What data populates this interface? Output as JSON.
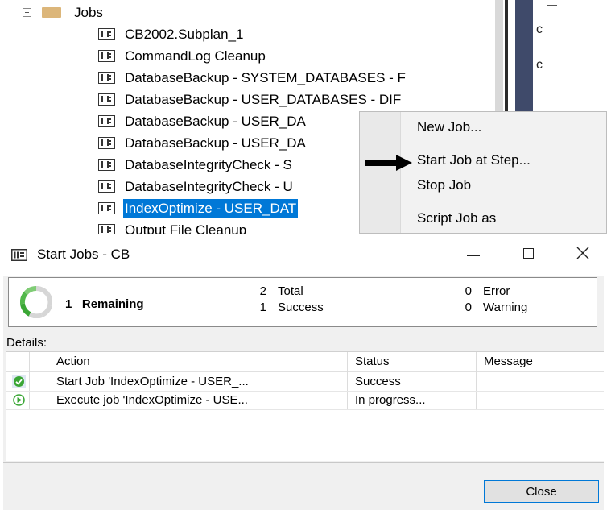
{
  "explorer": {
    "jobs_folder_label": "Jobs",
    "jobs": [
      "CB2002.Subplan_1",
      "CommandLog Cleanup",
      "DatabaseBackup - SYSTEM_DATABASES - F",
      "DatabaseBackup - USER_DATABASES - DIF",
      "DatabaseBackup - USER_DA",
      "DatabaseBackup - USER_DA",
      "DatabaseIntegrityCheck - S",
      "DatabaseIntegrityCheck - U",
      "IndexOptimize - USER_DAT",
      "Output File Cleanup"
    ],
    "selected_index": 8,
    "right_pane_chars": [
      "c",
      "c"
    ]
  },
  "context_menu": {
    "items": [
      "New Job...",
      "Start Job at Step...",
      "Stop Job",
      "Script Job as"
    ],
    "highlighted_item": "Start Job at Step..."
  },
  "dialog": {
    "title": "Start Jobs - CB",
    "summary": {
      "remaining_count": "1",
      "remaining_label": "Remaining",
      "total_count": "2",
      "total_label": "Total",
      "success_count": "1",
      "success_label": "Success",
      "error_count": "0",
      "error_label": "Error",
      "warning_count": "0",
      "warning_label": "Warning"
    },
    "details_label": "Details:",
    "columns": [
      "Action",
      "Status",
      "Message"
    ],
    "rows": [
      {
        "icon": "success-check-icon",
        "action": "Start Job 'IndexOptimize - USER_...",
        "status": "Success",
        "message": ""
      },
      {
        "icon": "play-progress-icon",
        "action": "Execute job 'IndexOptimize - USE...",
        "status": "In progress...",
        "message": ""
      }
    ],
    "close_label": "Close"
  },
  "colors": {
    "selection": "#0078d7",
    "folder": "#dcb67a",
    "success_green": "#3aa635",
    "dialog_background": "#f0f0f0"
  }
}
